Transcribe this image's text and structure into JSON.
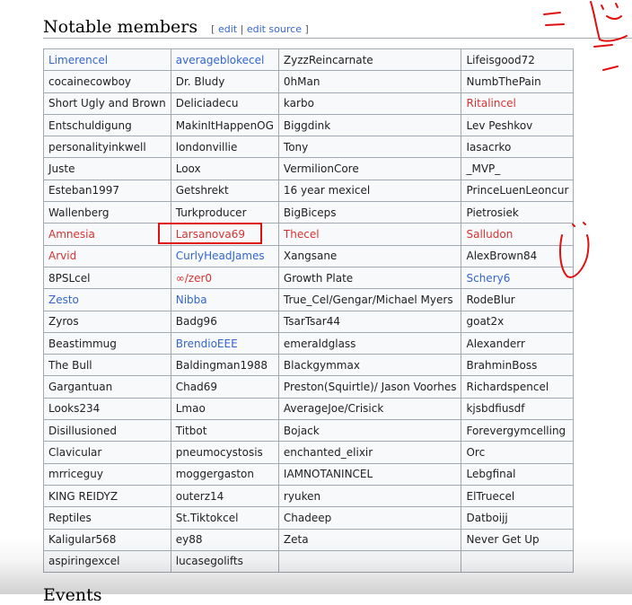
{
  "section": {
    "title": "Notable members",
    "edit_open": "[",
    "edit_label": "edit",
    "edit_sep": "|",
    "edit_source_label": "edit source",
    "edit_close": "]"
  },
  "members": [
    [
      {
        "t": "Limerencel",
        "c": "blue"
      },
      {
        "t": "averageblokecel",
        "c": "blue"
      },
      {
        "t": "ZyzzReincarnate",
        "c": "plain"
      },
      {
        "t": "Lifeisgood72",
        "c": "plain"
      }
    ],
    [
      {
        "t": "cocainecowboy",
        "c": "plain"
      },
      {
        "t": "Dr. Bludy",
        "c": "plain"
      },
      {
        "t": "0hMan",
        "c": "plain"
      },
      {
        "t": "NumbThePain",
        "c": "plain"
      }
    ],
    [
      {
        "t": "Short Ugly and Brown",
        "c": "plain"
      },
      {
        "t": "Deliciadecu",
        "c": "plain"
      },
      {
        "t": "karbo",
        "c": "plain"
      },
      {
        "t": "Ritalincel",
        "c": "red"
      }
    ],
    [
      {
        "t": "Entschuldigung",
        "c": "plain"
      },
      {
        "t": "MakinItHappenOG",
        "c": "plain"
      },
      {
        "t": "Biggdink",
        "c": "plain"
      },
      {
        "t": "Lev Peshkov",
        "c": "plain"
      }
    ],
    [
      {
        "t": "personalityinkwell",
        "c": "plain"
      },
      {
        "t": "londonvillie",
        "c": "plain"
      },
      {
        "t": "Tony",
        "c": "plain"
      },
      {
        "t": "Iasacrko",
        "c": "plain"
      }
    ],
    [
      {
        "t": "Juste",
        "c": "plain"
      },
      {
        "t": "Loox",
        "c": "plain"
      },
      {
        "t": "VermilionCore",
        "c": "plain"
      },
      {
        "t": "_MVP_",
        "c": "plain"
      }
    ],
    [
      {
        "t": "Esteban1997",
        "c": "plain"
      },
      {
        "t": "Getshrekt",
        "c": "plain"
      },
      {
        "t": "16 year mexicel",
        "c": "plain"
      },
      {
        "t": "PrinceLuenLeoncur",
        "c": "plain"
      }
    ],
    [
      {
        "t": "Wallenberg",
        "c": "plain"
      },
      {
        "t": "Turkproducer",
        "c": "plain"
      },
      {
        "t": "BigBiceps",
        "c": "plain"
      },
      {
        "t": "Pietrosiek",
        "c": "plain"
      }
    ],
    [
      {
        "t": "Amnesia",
        "c": "red"
      },
      {
        "t": "Larsanova69",
        "c": "red"
      },
      {
        "t": "Thecel",
        "c": "red"
      },
      {
        "t": "Salludon",
        "c": "red"
      }
    ],
    [
      {
        "t": "Arvid",
        "c": "red"
      },
      {
        "t": "CurlyHeadJames",
        "c": "blue"
      },
      {
        "t": "Xangsane",
        "c": "plain"
      },
      {
        "t": "AlexBrown84",
        "c": "plain"
      }
    ],
    [
      {
        "t": "8PSLcel",
        "c": "plain"
      },
      {
        "t": "∞/zer0",
        "c": "red"
      },
      {
        "t": "Growth Plate",
        "c": "plain"
      },
      {
        "t": "Schery6",
        "c": "blue"
      }
    ],
    [
      {
        "t": "Zesto",
        "c": "blue"
      },
      {
        "t": "Nibba",
        "c": "blue"
      },
      {
        "t": "True_Cel/Gengar/Michael Myers",
        "c": "plain"
      },
      {
        "t": "RodeBlur",
        "c": "plain"
      }
    ],
    [
      {
        "t": "Zyros",
        "c": "plain"
      },
      {
        "t": "Badg96",
        "c": "plain"
      },
      {
        "t": "TsarTsar44",
        "c": "plain"
      },
      {
        "t": "goat2x",
        "c": "plain"
      }
    ],
    [
      {
        "t": "Beastimmug",
        "c": "plain"
      },
      {
        "t": "BrendioEEE",
        "c": "blue"
      },
      {
        "t": "emeraldglass",
        "c": "plain"
      },
      {
        "t": "Alexanderr",
        "c": "plain"
      }
    ],
    [
      {
        "t": "The Bull",
        "c": "plain"
      },
      {
        "t": "Baldingman1988",
        "c": "plain"
      },
      {
        "t": "Blackgymmax",
        "c": "plain"
      },
      {
        "t": "BrahminBoss",
        "c": "plain"
      }
    ],
    [
      {
        "t": "Gargantuan",
        "c": "plain"
      },
      {
        "t": "Chad69",
        "c": "plain"
      },
      {
        "t": "Preston(Squirtle)/ Jason Voorhes",
        "c": "plain"
      },
      {
        "t": "Richardspencel",
        "c": "plain"
      }
    ],
    [
      {
        "t": "Looks234",
        "c": "plain"
      },
      {
        "t": "Lmao",
        "c": "plain"
      },
      {
        "t": "AverageJoe/Crisick",
        "c": "plain"
      },
      {
        "t": "kjsbdfiusdf",
        "c": "plain"
      }
    ],
    [
      {
        "t": "Disillusioned",
        "c": "plain"
      },
      {
        "t": "Titbot",
        "c": "plain"
      },
      {
        "t": "Bojack",
        "c": "plain"
      },
      {
        "t": "Forevergymcelling",
        "c": "plain"
      }
    ],
    [
      {
        "t": "Clavicular",
        "c": "plain"
      },
      {
        "t": "pneumocystosis",
        "c": "plain"
      },
      {
        "t": "enchanted_elixir",
        "c": "plain"
      },
      {
        "t": "Orc",
        "c": "plain"
      }
    ],
    [
      {
        "t": "mrriceguy",
        "c": "plain"
      },
      {
        "t": "moggergaston",
        "c": "plain"
      },
      {
        "t": "IAMNOTANINCEL",
        "c": "plain"
      },
      {
        "t": "Lebgfinal",
        "c": "plain"
      }
    ],
    [
      {
        "t": "KING REIDYZ",
        "c": "plain"
      },
      {
        "t": "outerz14",
        "c": "plain"
      },
      {
        "t": "ryuken",
        "c": "plain"
      },
      {
        "t": "ElTruecel",
        "c": "plain"
      }
    ],
    [
      {
        "t": "Reptiles",
        "c": "plain"
      },
      {
        "t": "St.Tiktokcel",
        "c": "plain"
      },
      {
        "t": "Chadeep",
        "c": "plain"
      },
      {
        "t": "Datboijj",
        "c": "plain"
      }
    ],
    [
      {
        "t": "Kaligular568",
        "c": "plain"
      },
      {
        "t": "ey88",
        "c": "plain"
      },
      {
        "t": "Zeta",
        "c": "plain"
      },
      {
        "t": "Never Get Up",
        "c": "plain"
      }
    ],
    [
      {
        "t": "aspiringexcel",
        "c": "plain"
      },
      {
        "t": "lucasegolifts",
        "c": "plain"
      },
      {
        "t": "",
        "c": "plain"
      },
      {
        "t": "",
        "c": "plain"
      }
    ]
  ],
  "next_section": {
    "title": "Events"
  },
  "colors": {
    "link_blue": "#3366cc",
    "link_red": "#d73333",
    "annotation_red": "#e01010"
  }
}
